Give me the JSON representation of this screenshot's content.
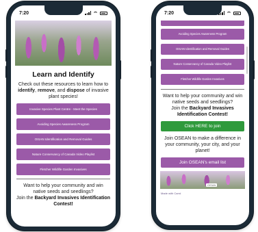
{
  "left_phone": {
    "status_time": "7:20",
    "title": "Learn and Identify",
    "intro": {
      "part1": "Check out these resources to learn how to ",
      "identify": "identify",
      "sep1": ", ",
      "remove": "remove",
      "sep2": ", and ",
      "dispose": "dispose",
      "part2": " of invasive plant species!"
    },
    "buttons": [
      "Invasive Species Plant Centre - Meet the Species",
      "Avoiding Species Awareness Program",
      "OISAN Identification and Removal Guides",
      "Nature Conservancy of Canada Video Playlist",
      "Fletcher Wildlife Garden Invasives"
    ],
    "prompt": {
      "line": "Want to help your community and win native seeds and seedlings?",
      "join": "Join the ",
      "contest": "Backyard Invasives Identification Contest!"
    }
  },
  "right_phone": {
    "status_time": "7:20",
    "buttons": [
      "Avoiding Species Awareness Program",
      "OISAN Identification and Removal Guides",
      "Nature Conservancy of Canada Video Playlist",
      "Fletcher Wildlife Garden Invasives"
    ],
    "prompt": {
      "line": "Want to help your community and win native seeds and seedlings?",
      "join": "Join the ",
      "contest": "Backyard Invasives Identification Contest!"
    },
    "cta_button": "Click HERE to join",
    "oasean_text": "Join OSEAN to make a difference in your community, your city, and your planet!",
    "email_button": "Join OSEAN's email list",
    "strip_badge": "OISAN",
    "footer_link": "Made with Carrd"
  },
  "colors": {
    "purple_button": "#9b5aa8",
    "green_button": "#2f9a3c",
    "phone_frame": "#1b2a36"
  }
}
